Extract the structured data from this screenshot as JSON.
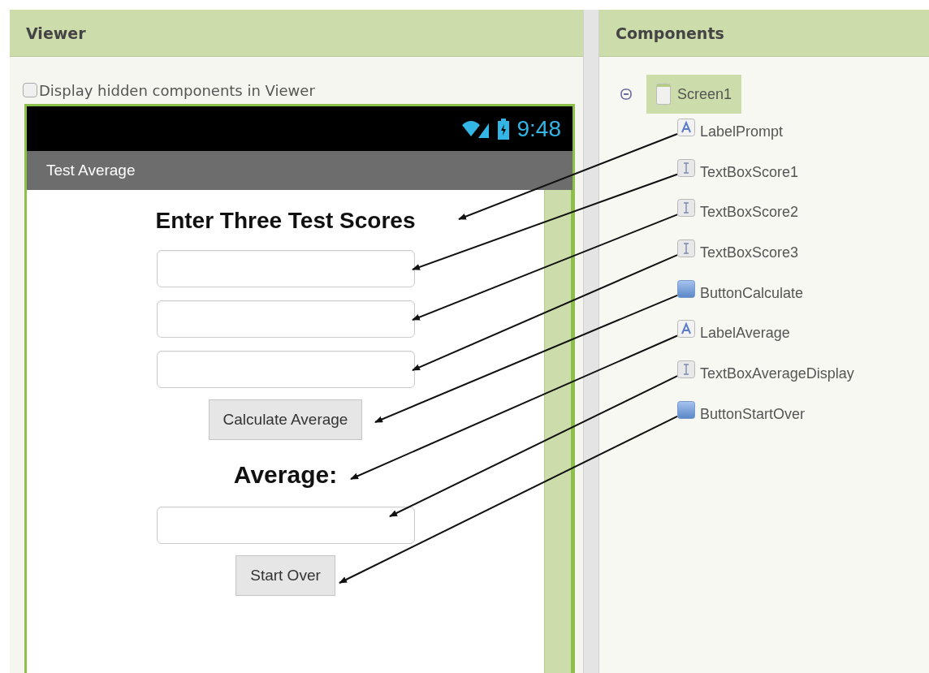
{
  "viewer": {
    "title": "Viewer",
    "hidden_option": {
      "label": "Display hidden components in Viewer",
      "checked": false
    }
  },
  "phone": {
    "time": "9:48",
    "app_title": "Test Average",
    "widgets": [
      {
        "kind": "label",
        "text": "Enter Three Test Scores"
      },
      {
        "kind": "textbox"
      },
      {
        "kind": "textbox"
      },
      {
        "kind": "textbox"
      },
      {
        "kind": "button",
        "text": "Calculate Average"
      },
      {
        "kind": "label",
        "text": "Average:"
      },
      {
        "kind": "textbox"
      },
      {
        "kind": "button",
        "text": "Start Over"
      }
    ]
  },
  "components": {
    "title": "Components",
    "tree": {
      "name": "Screen1",
      "kind": "screen",
      "expanded": true,
      "selected": true,
      "children": [
        {
          "name": "LabelPrompt",
          "kind": "label",
          "selected": false
        },
        {
          "name": "TextBoxScore1",
          "kind": "textbox",
          "selected": false
        },
        {
          "name": "TextBoxScore2",
          "kind": "textbox",
          "selected": false
        },
        {
          "name": "TextBoxScore3",
          "kind": "textbox",
          "selected": false
        },
        {
          "name": "ButtonCalculate",
          "kind": "button",
          "selected": false
        },
        {
          "name": "LabelAverage",
          "kind": "label",
          "selected": false
        },
        {
          "name": "TextBoxAverageDisplay",
          "kind": "textbox",
          "selected": false
        },
        {
          "name": "ButtonStartOver",
          "kind": "button",
          "selected": false
        }
      ]
    }
  }
}
